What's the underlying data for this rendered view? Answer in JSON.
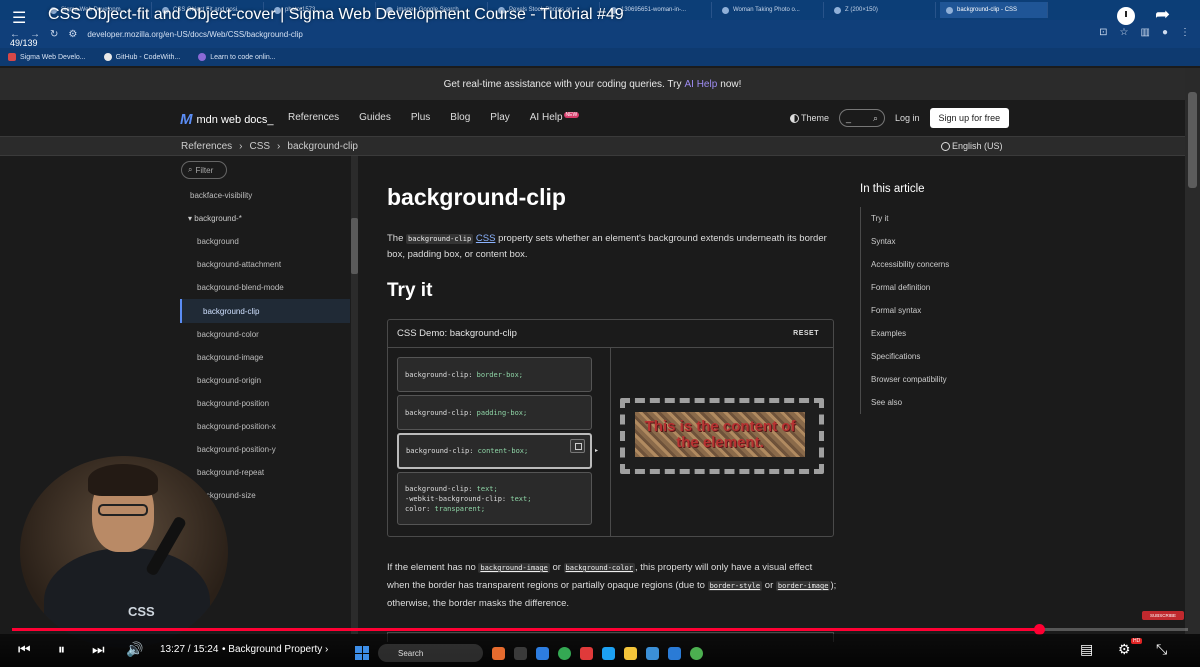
{
  "video": {
    "title": "CSS Object-fit and Object-cover | Sigma Web Development Course - Tutorial #49",
    "playlist_position": "49/139",
    "current_time": "13:27",
    "duration": "15:24",
    "chapter": "Background Property",
    "progress_fraction": 0.873,
    "subscribe_label": "SUBSCRIBE",
    "quality_badge": "HD"
  },
  "browser": {
    "tabs": [
      {
        "label": "Sigma Web Developm..."
      },
      {
        "label": "CSS Object Fit and posi..."
      },
      {
        "label": "photo-1573..."
      },
      {
        "label": "image - Google Search"
      },
      {
        "label": "Pexels Stock Photos an..."
      },
      {
        "label": "130695651-woman-in-..."
      },
      {
        "label": "Woman Taking Photo o..."
      },
      {
        "label": "Z (200×150)"
      },
      {
        "label": "background-clip - CSS"
      }
    ],
    "url": "developer.mozilla.org/en-US/docs/Web/CSS/background-clip",
    "bookmarks": [
      {
        "label": "Sigma Web Develo..."
      },
      {
        "label": "GitHub - CodeWith..."
      },
      {
        "label": "Learn to code onlin..."
      }
    ]
  },
  "mdn": {
    "banner": {
      "prefix": "Get real-time assistance with your coding queries. Try",
      "link": "AI Help",
      "suffix": "now!"
    },
    "logo": "mdn web docs_",
    "nav": [
      "References",
      "Guides",
      "Plus",
      "Blog",
      "Play"
    ],
    "ai_help": "AI Help",
    "ai_help_badge": "NEW",
    "theme": "Theme",
    "search_placeholder": "_",
    "login": "Log in",
    "signup": "Sign up for free",
    "breadcrumbs": [
      "References",
      "CSS",
      "background-clip"
    ],
    "language": "English (US)"
  },
  "sidebar": {
    "filter_placeholder": "Filter",
    "items": [
      {
        "label": "backface-visibility"
      },
      {
        "label": "▾ background-*"
      },
      {
        "label": "background"
      },
      {
        "label": "background-attachment"
      },
      {
        "label": "background-blend-mode"
      },
      {
        "label": "background-clip"
      },
      {
        "label": "background-color"
      },
      {
        "label": "background-image"
      },
      {
        "label": "background-origin"
      },
      {
        "label": "background-position"
      },
      {
        "label": "background-position-x"
      },
      {
        "label": "background-position-y"
      },
      {
        "label": "background-repeat"
      },
      {
        "label": "background-size"
      }
    ]
  },
  "article": {
    "title": "background-clip",
    "intro": {
      "the": "The",
      "code": "background-clip",
      "link": "CSS",
      "rest": "property sets whether an element's background extends underneath its border box, padding box, or content box."
    },
    "try_it": "Try it",
    "demo": {
      "title": "CSS Demo: background-clip",
      "reset": "RESET",
      "choices": [
        {
          "prop": "background-clip:",
          "val": "border-box;"
        },
        {
          "prop": "background-clip:",
          "val": "padding-box;"
        },
        {
          "prop": "background-clip:",
          "val": "content-box;"
        }
      ],
      "choice4": {
        "line1_prop": "background-clip:",
        "line1_val": "text;",
        "line2_prop": "-webkit-background-clip:",
        "line2_val": "text;",
        "line3_prop": "color:",
        "line3_val": "transparent;"
      },
      "output_text": "This is the content of the element."
    },
    "para2": {
      "a": "If the element has no",
      "code1": "background-image",
      "b": "or",
      "code2": "background-color",
      "c": ", this property will only have a visual effect when the border has transparent regions or partially opaque regions (due to",
      "code3": "border-style",
      "d": "or",
      "code4": "border-image",
      "e": "); otherwise, the border masks the difference."
    }
  },
  "toc": {
    "title": "In this article",
    "items": [
      {
        "label": "Try it"
      },
      {
        "label": "Syntax"
      },
      {
        "label": "Accessibility concerns"
      },
      {
        "label": "Formal definition"
      },
      {
        "label": "Formal syntax"
      },
      {
        "label": "Examples"
      },
      {
        "label": "Specifications"
      },
      {
        "label": "Browser compatibility"
      },
      {
        "label": "See also"
      }
    ]
  },
  "taskbar": {
    "search_placeholder": "Search"
  },
  "colors": {
    "accent": "#5b8df5",
    "progress": "#ff0033",
    "ai_link": "#9e8cf3"
  }
}
